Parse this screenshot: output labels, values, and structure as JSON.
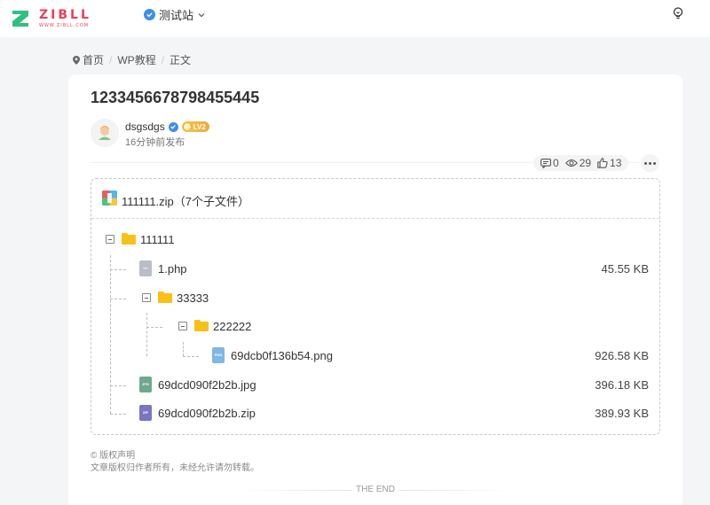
{
  "header": {
    "logo_text": "ZIBLL",
    "logo_sub": "WWW.ZIBLL.COM",
    "site_name": "测试站"
  },
  "breadcrumb": [
    "首页",
    "WP教程",
    "正文"
  ],
  "post": {
    "title": "1233456678798455445",
    "author": "dsgsdgs",
    "level": "LV2",
    "time": "16分钟前发布",
    "comments": "0",
    "views": "29",
    "likes": "13"
  },
  "file": {
    "title": "111111.zip（7个子文件）",
    "tree": [
      {
        "name": "111111",
        "type": "folder",
        "size": ""
      },
      {
        "name": "1.php",
        "type": "php",
        "size": "45.55 KB"
      },
      {
        "name": "33333",
        "type": "folder",
        "size": ""
      },
      {
        "name": "222222",
        "type": "folder",
        "size": ""
      },
      {
        "name": "69dcb0f136b54.png",
        "type": "png",
        "size": "926.58 KB"
      },
      {
        "name": "69dcd090f2b2b.jpg",
        "type": "jpg",
        "size": "396.18 KB"
      },
      {
        "name": "69dcd090f2b2b.zip",
        "type": "zip",
        "size": "389.93 KB"
      }
    ]
  },
  "copyright": {
    "heading": "© 版权声明",
    "text": "文章版权归作者所有，未经允许请勿转载。"
  },
  "the_end": "THE END",
  "colors": {
    "brand": "#ef3d55",
    "folder": "#f9c117",
    "verify": "#3d8ef2"
  }
}
